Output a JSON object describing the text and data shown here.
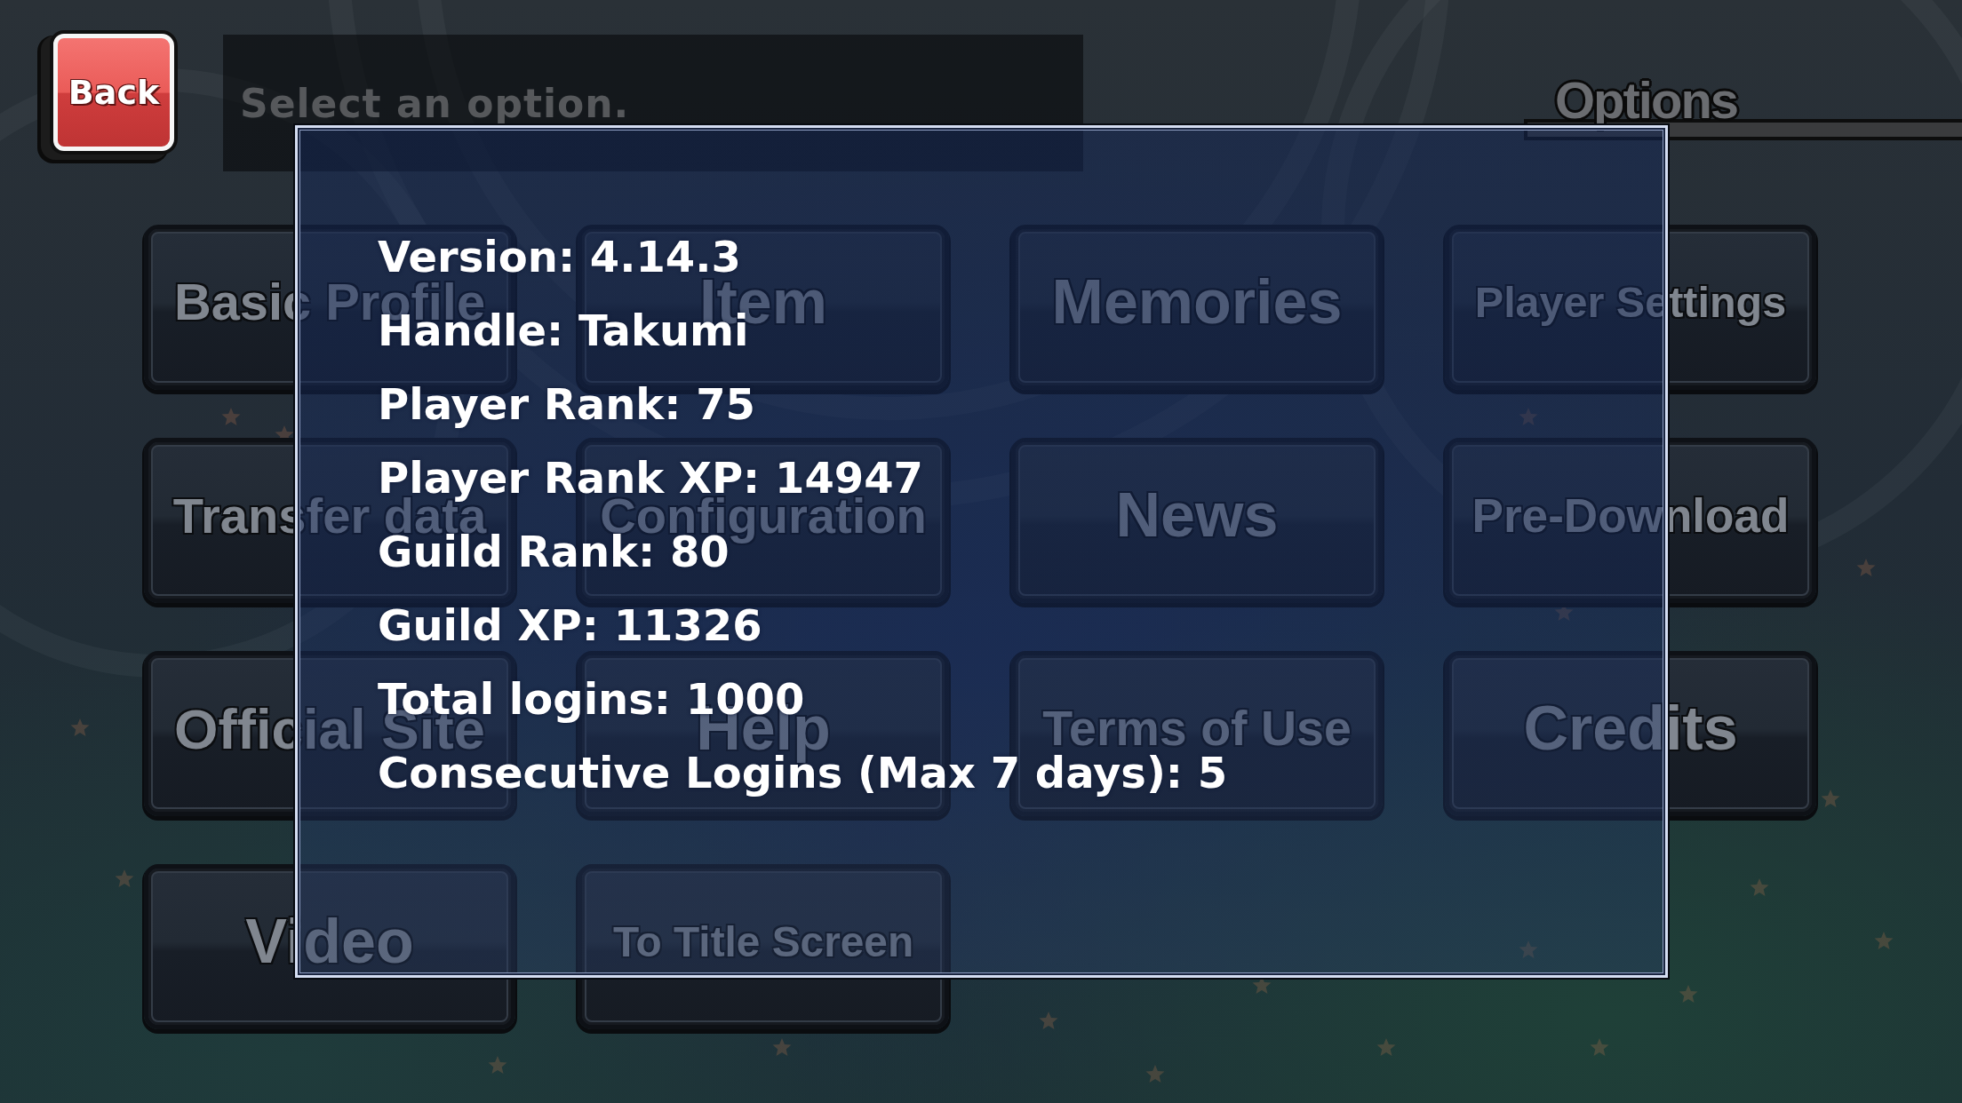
{
  "back_button": {
    "label": "Back"
  },
  "header": {
    "prompt": "Select an option."
  },
  "title": "Options",
  "menu_buttons": [
    {
      "label": "Basic Profile"
    },
    {
      "label": "Item"
    },
    {
      "label": "Memories"
    },
    {
      "label": "Player Settings"
    },
    {
      "label": "Transfer data"
    },
    {
      "label": "Configuration"
    },
    {
      "label": "News"
    },
    {
      "label": "Pre-Download"
    },
    {
      "label": "Official Site"
    },
    {
      "label": "Help"
    },
    {
      "label": "Terms of Use"
    },
    {
      "label": "Credits"
    },
    {
      "label": "Video"
    },
    {
      "label": "To Title Screen"
    }
  ],
  "info_dialog": {
    "lines": [
      "Version: 4.14.3",
      "Handle: Takumi",
      "Player Rank: 75",
      "Player Rank XP: 14947",
      "Guild Rank: 80",
      "Guild XP: 11326",
      "Total logins: 1000",
      "Consecutive Logins (Max 7 days): 5"
    ]
  }
}
